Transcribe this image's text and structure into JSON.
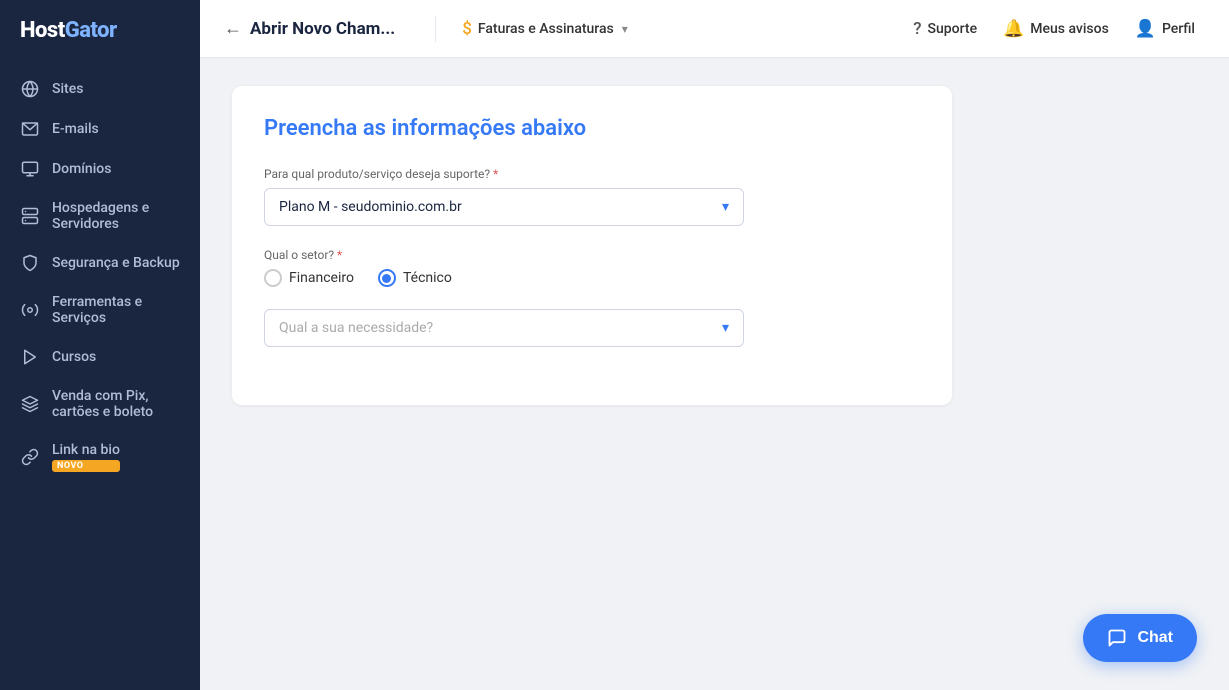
{
  "sidebar": {
    "logo": "HostGator",
    "items": [
      {
        "id": "sites",
        "label": "Sites",
        "icon": "globe"
      },
      {
        "id": "emails",
        "label": "E-mails",
        "icon": "email"
      },
      {
        "id": "dominios",
        "label": "Domínios",
        "icon": "domain"
      },
      {
        "id": "hospedagens",
        "label": "Hospedagens e Servidores",
        "icon": "server"
      },
      {
        "id": "seguranca",
        "label": "Segurança e Backup",
        "icon": "shield"
      },
      {
        "id": "ferramentas",
        "label": "Ferramentas e Serviços",
        "icon": "tools"
      },
      {
        "id": "cursos",
        "label": "Cursos",
        "icon": "courses"
      },
      {
        "id": "venda",
        "label": "Venda com Pix, cartões e boleto",
        "icon": "pix"
      },
      {
        "id": "linkbio",
        "label": "Link na bio",
        "icon": "link",
        "badge": "NOVO"
      }
    ]
  },
  "topnav": {
    "back_label": "Abrir Novo Cham...",
    "faturas_label": "Faturas e Assinaturas",
    "suporte_label": "Suporte",
    "avisos_label": "Meus avisos",
    "perfil_label": "Perfil"
  },
  "form": {
    "title_plain": "Preencha as ",
    "title_highlight": "informações abaixo",
    "product_label": "Para qual produto/serviço deseja suporte?",
    "product_required": "*",
    "product_value": "Plano M - seudominio.com.br",
    "sector_label": "Qual o setor?",
    "sector_required": "*",
    "sector_options": [
      {
        "id": "financeiro",
        "label": "Financeiro",
        "selected": false
      },
      {
        "id": "tecnico",
        "label": "Técnico",
        "selected": true
      }
    ],
    "need_label": "Qual a sua necessidade?",
    "need_required": "*",
    "need_placeholder": "Qual a sua necessidade?"
  },
  "chat": {
    "label": "Chat"
  }
}
